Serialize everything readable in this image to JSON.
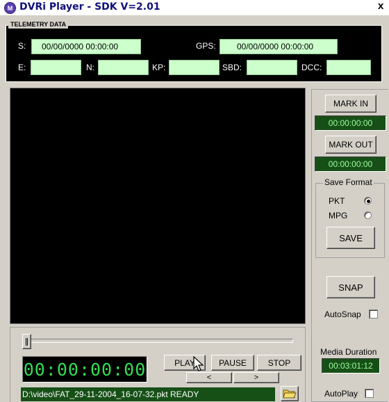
{
  "window": {
    "title": "DVRi Player - SDK V=2.01",
    "close": "x",
    "logo": "M"
  },
  "telemetry": {
    "group_label": "TELEMETRY DATA",
    "s_label": "S:",
    "s_value": "00/00/0000 00:00:00",
    "gps_label": "GPS:",
    "gps_value": "00/00/0000 00:00:00",
    "e_label": "E:",
    "e_value": "",
    "n_label": "N:",
    "n_value": "",
    "kp_label": "KP:",
    "kp_value": "",
    "sbd_label": "SBD:",
    "sbd_value": "",
    "dcc_label": "DCC:",
    "dcc_value": ""
  },
  "marks": {
    "mark_in_label": "MARK IN",
    "mark_in_time": "00:00:00:00",
    "mark_out_label": "MARK OUT",
    "mark_out_time": "00:00:00:00"
  },
  "save_format": {
    "label": "Save Format",
    "options": [
      {
        "label": "PKT",
        "selected": true
      },
      {
        "label": "MPG",
        "selected": false
      }
    ],
    "save_label": "SAVE"
  },
  "snap": {
    "label": "SNAP",
    "autosnap_label": "AutoSnap",
    "autosnap_checked": false
  },
  "media": {
    "duration_label": "Media Duration",
    "duration_value": "00:03:01:12",
    "autoplay_label": "AutoPlay",
    "autoplay_checked": false
  },
  "transport": {
    "timecode": "00:00:00:00",
    "play": "PLAY",
    "pause": "PAUSE",
    "stop": "STOP",
    "step_back": "<",
    "step_forward": ">",
    "slider_position": 0.0
  },
  "status": {
    "text": "D:\\video\\FAT_29-11-2004_16-07-32.pkt  READY"
  },
  "icons": {
    "folder": "folder-open-icon",
    "cursor": "mouse-pointer-icon"
  },
  "colors": {
    "field_bg": "#ccffcc",
    "timecode_bg": "#175017",
    "timecode_fg": "#9dff9d",
    "lcd_fg": "#33dd55"
  }
}
